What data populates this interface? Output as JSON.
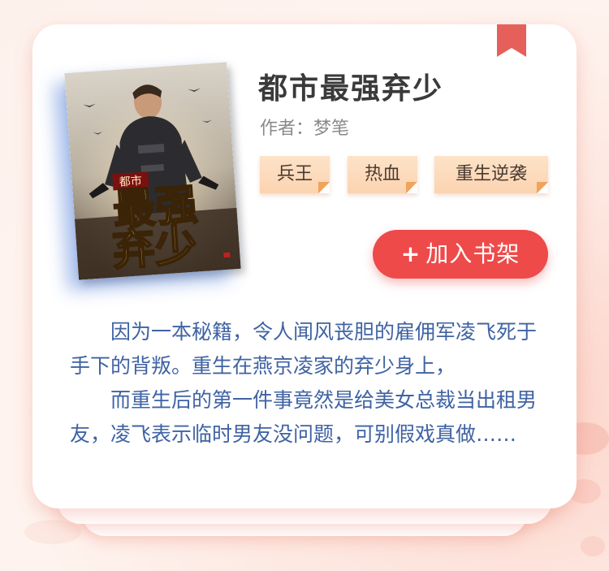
{
  "book": {
    "title": "都市最强弃少",
    "author_label": "作者：",
    "author": "梦笔",
    "tags": [
      "兵王",
      "热血",
      "重生逆袭"
    ],
    "add_button_icon": "+",
    "add_button_label": "加入书架",
    "description_paragraphs": [
      "因为一本秘籍，令人闻风丧胆的雇佣军凌飞死于手下的背叛。重生在燕京凌家的弃少身上，",
      "而重生后的第一件事竟然是给美女总裁当出租男友，凌飞表示临时男友没问题，可别假戏真做……"
    ]
  },
  "cover": {
    "badge_text": "都市",
    "title_line1": "最强",
    "title_line2": "弃少"
  },
  "colors": {
    "accent_red": "#ee4a4a",
    "tag_bg": "#fbd3b0",
    "description_blue": "#3f63a3",
    "bookmark_red": "#e5605a"
  },
  "icons": {
    "bookmark": "bookmark-ribbon-icon",
    "add": "plus-icon"
  }
}
